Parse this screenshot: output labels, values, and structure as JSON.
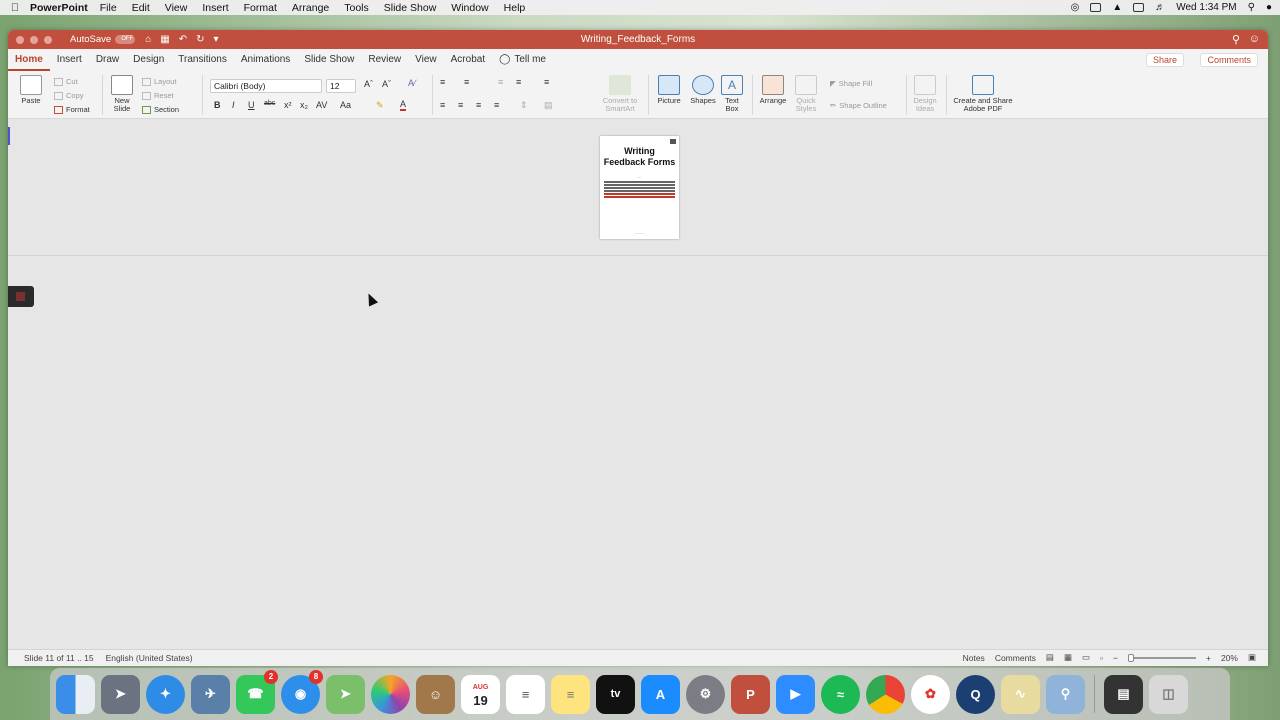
{
  "menubar": {
    "app_name": "PowerPoint",
    "items": [
      "File",
      "Edit",
      "View",
      "Insert",
      "Format",
      "Arrange",
      "Tools",
      "Slide Show",
      "Window",
      "Help"
    ],
    "clock": "Wed 1:34 PM"
  },
  "window": {
    "autosave_label": "AutoSave",
    "autosave_state": "OFF",
    "title": "Writing_Feedback_Forms"
  },
  "tabs": [
    "Home",
    "Insert",
    "Draw",
    "Design",
    "Transitions",
    "Animations",
    "Slide Show",
    "Review",
    "View",
    "Acrobat"
  ],
  "tell_me": "Tell me",
  "share_label": "Share",
  "comments_label": "Comments",
  "ribbon": {
    "paste": "Paste",
    "cut": "Cut",
    "copy": "Copy",
    "format": "Format",
    "new_slide_1": "New",
    "new_slide_2": "Slide",
    "layout": "Layout",
    "reset": "Reset",
    "section": "Section",
    "font_name": "Calibri (Body)",
    "font_size": "12",
    "bold": "B",
    "italic": "I",
    "underline": "U",
    "strike": "abc",
    "convert_1": "Convert to",
    "convert_2": "SmartArt",
    "picture": "Picture",
    "shapes": "Shapes",
    "textbox_1": "Text",
    "textbox_2": "Box",
    "arrange": "Arrange",
    "quick_styles_1": "Quick",
    "quick_styles_2": "Styles",
    "shape_fill": "Shape Fill",
    "shape_outline": "Shape Outline",
    "design_ideas_1": "Design",
    "design_ideas_2": "Ideas",
    "adobe_1": "Create and Share",
    "adobe_2": "Adobe PDF"
  },
  "slide": {
    "title_line1": "Writing",
    "title_line2": "Feedback Forms"
  },
  "status": {
    "slide_info": "Slide 11 of 11 .. 15",
    "language": "English (United States)",
    "notes": "Notes",
    "comments": "Comments",
    "zoom": "20%"
  },
  "dock": {
    "messages_badge": "2",
    "chat_badge": "8",
    "calendar_month": "AUG",
    "calendar_day": "19",
    "tv_label": "tv"
  },
  "colors": {
    "title_bar": "#c0503d",
    "accent": "#b9452f"
  }
}
